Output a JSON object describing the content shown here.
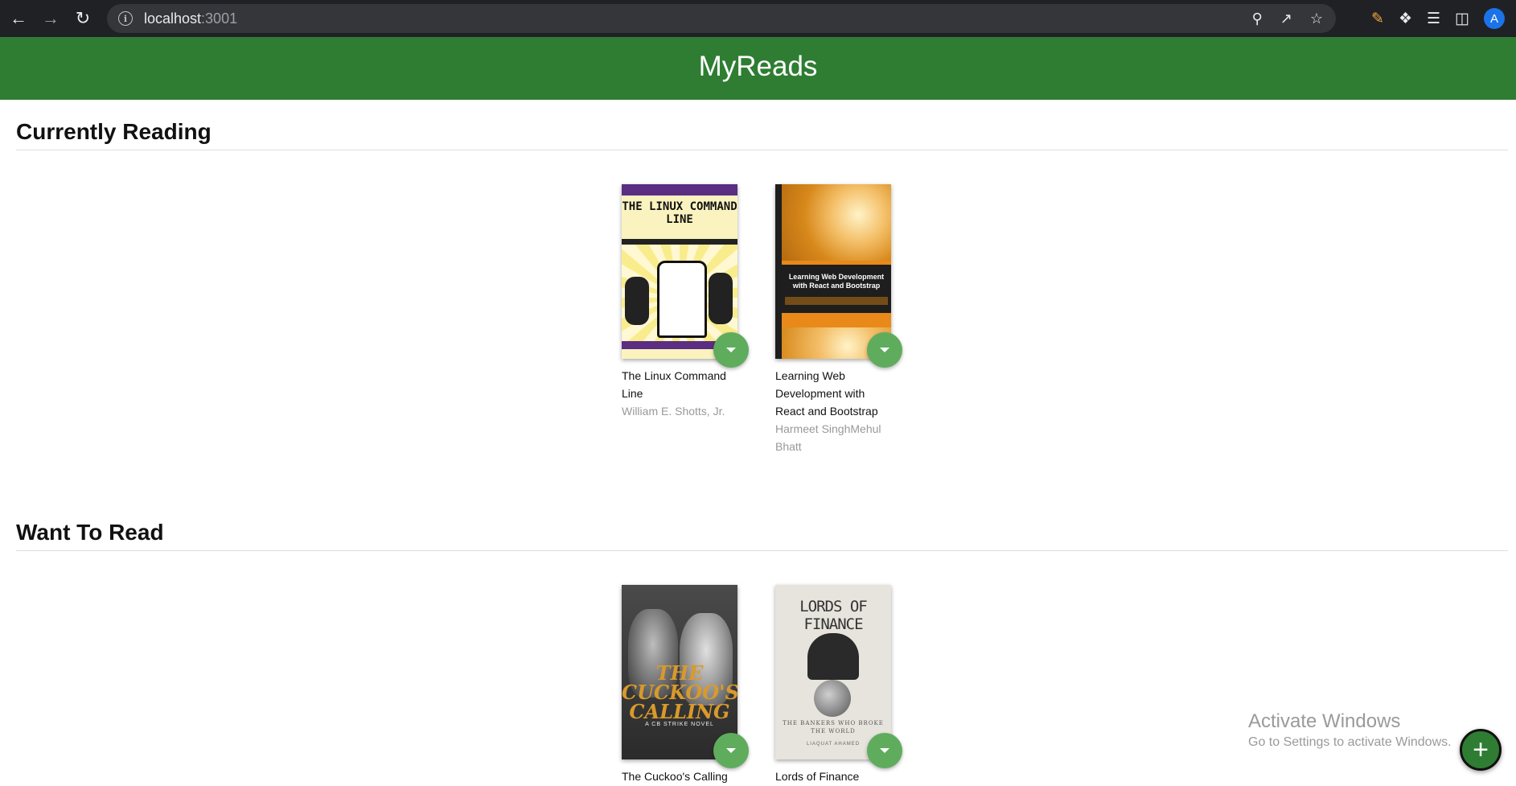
{
  "browser": {
    "url_host": "localhost",
    "url_port": ":3001",
    "profile_initial": "A"
  },
  "app": {
    "title": "MyReads"
  },
  "shelves": [
    {
      "title": "Currently Reading",
      "books": [
        {
          "title": "The Linux Command Line",
          "authors": "William E. Shotts, Jr."
        },
        {
          "title": "Learning Web Development with React and Bootstrap",
          "authors": "Harmeet SinghMehul Bhatt"
        }
      ]
    },
    {
      "title": "Want To Read",
      "books": [
        {
          "title": "The Cuckoo's Calling",
          "authors": ""
        },
        {
          "title": "Lords of Finance",
          "authors": ""
        }
      ]
    }
  ],
  "covers": {
    "linux": {
      "title": "THE LINUX COMMAND LINE"
    },
    "react": {
      "title": "Learning Web Development with React and Bootstrap"
    },
    "cuckoo": {
      "title": "THE CUCKOO'S CALLING",
      "subtitle": "A CB STRIKE NOVEL"
    },
    "lords": {
      "title": "LORDS OF FINANCE",
      "subtitle": "THE BANKERS WHO BROKE THE WORLD",
      "author": "LIAQUAT AHAMED"
    }
  },
  "watermark": {
    "title": "Activate Windows",
    "subtitle": "Go to Settings to activate Windows."
  },
  "fab": {
    "label": "+"
  }
}
